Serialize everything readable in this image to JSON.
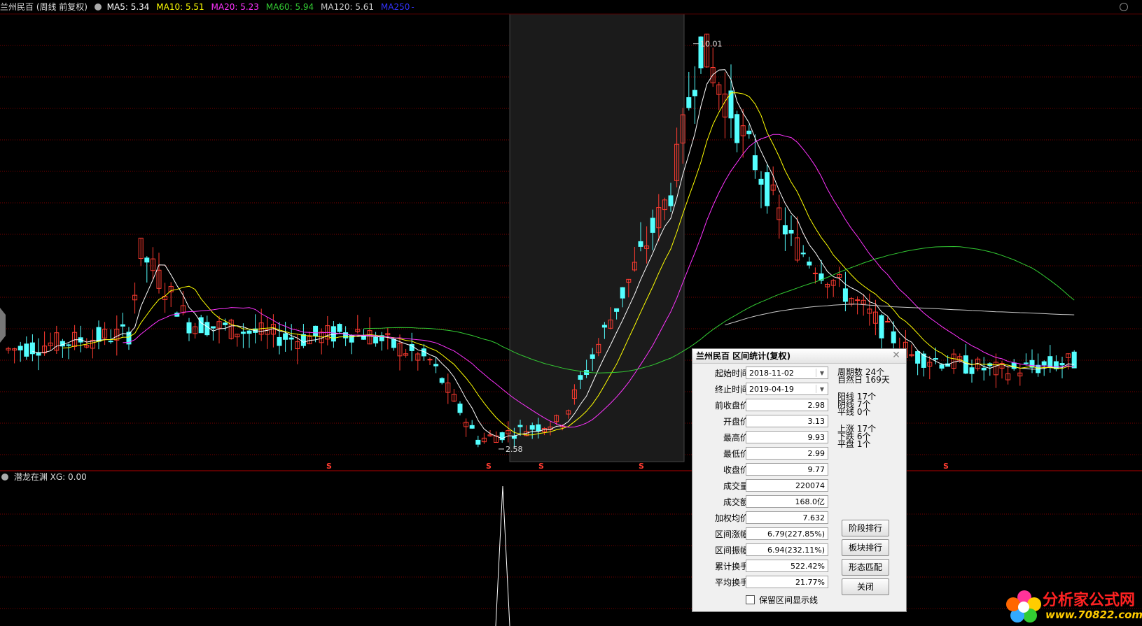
{
  "header": {
    "title": "兰州民百 (周线 前复权)",
    "ma5": "MA5: 5.34",
    "ma10": "MA10: 5.51",
    "ma20": "MA20: 5.23",
    "ma60": "MA60: 5.94",
    "ma120": "MA120: 5.61",
    "ma250": "MA250",
    "ma250_suffix": "-"
  },
  "colors": {
    "up": "#ff3b30",
    "down": "#54ffff",
    "ma5": "#ffffff",
    "ma10": "#ffff00",
    "ma20": "#ff33ff",
    "ma60": "#33cc33",
    "ma120": "#cccccc",
    "ma250": "#3333ff",
    "grid": "#7a0000"
  },
  "chart_labels": {
    "high": "10.01",
    "low": "2.58",
    "signal_mark": "S"
  },
  "indicator": {
    "label": "潜龙在渊 XG: 0.00"
  },
  "dialog": {
    "title": "兰州民百 区间统计(复权)",
    "rows": [
      {
        "label": "起始时间",
        "value": "2018-11-02"
      },
      {
        "label": "终止时间",
        "value": "2019-04-19"
      },
      {
        "label": "前收盘价",
        "value": "2.98"
      },
      {
        "label": "开盘价",
        "value": "3.13"
      },
      {
        "label": "最高价",
        "value": "9.93"
      },
      {
        "label": "最低价",
        "value": "2.99"
      },
      {
        "label": "收盘价",
        "value": "9.77"
      },
      {
        "label": "成交量",
        "value": "220074"
      },
      {
        "label": "成交额",
        "value": "168.0亿"
      },
      {
        "label": "加权均价",
        "value": "7.632"
      },
      {
        "label": "区间涨幅",
        "value": "6.79(227.85%)"
      },
      {
        "label": "区间振幅",
        "value": "6.94(232.11%)"
      },
      {
        "label": "累计换手",
        "value": "522.42%"
      },
      {
        "label": "平均换手",
        "value": "21.77%"
      }
    ],
    "stats": [
      "周期数 24个",
      "自然日 169天",
      "阳线 17个",
      "阴线 7个",
      "平线 0个",
      "上涨 17个",
      "下跌 6个",
      "平盘 1个"
    ],
    "buttons": [
      "阶段排行",
      "板块排行",
      "形态匹配",
      "关闭"
    ],
    "checkbox_label": "保留区间显示线"
  },
  "watermark": {
    "name": "分析家公式网",
    "url": "www.70822.com"
  }
}
